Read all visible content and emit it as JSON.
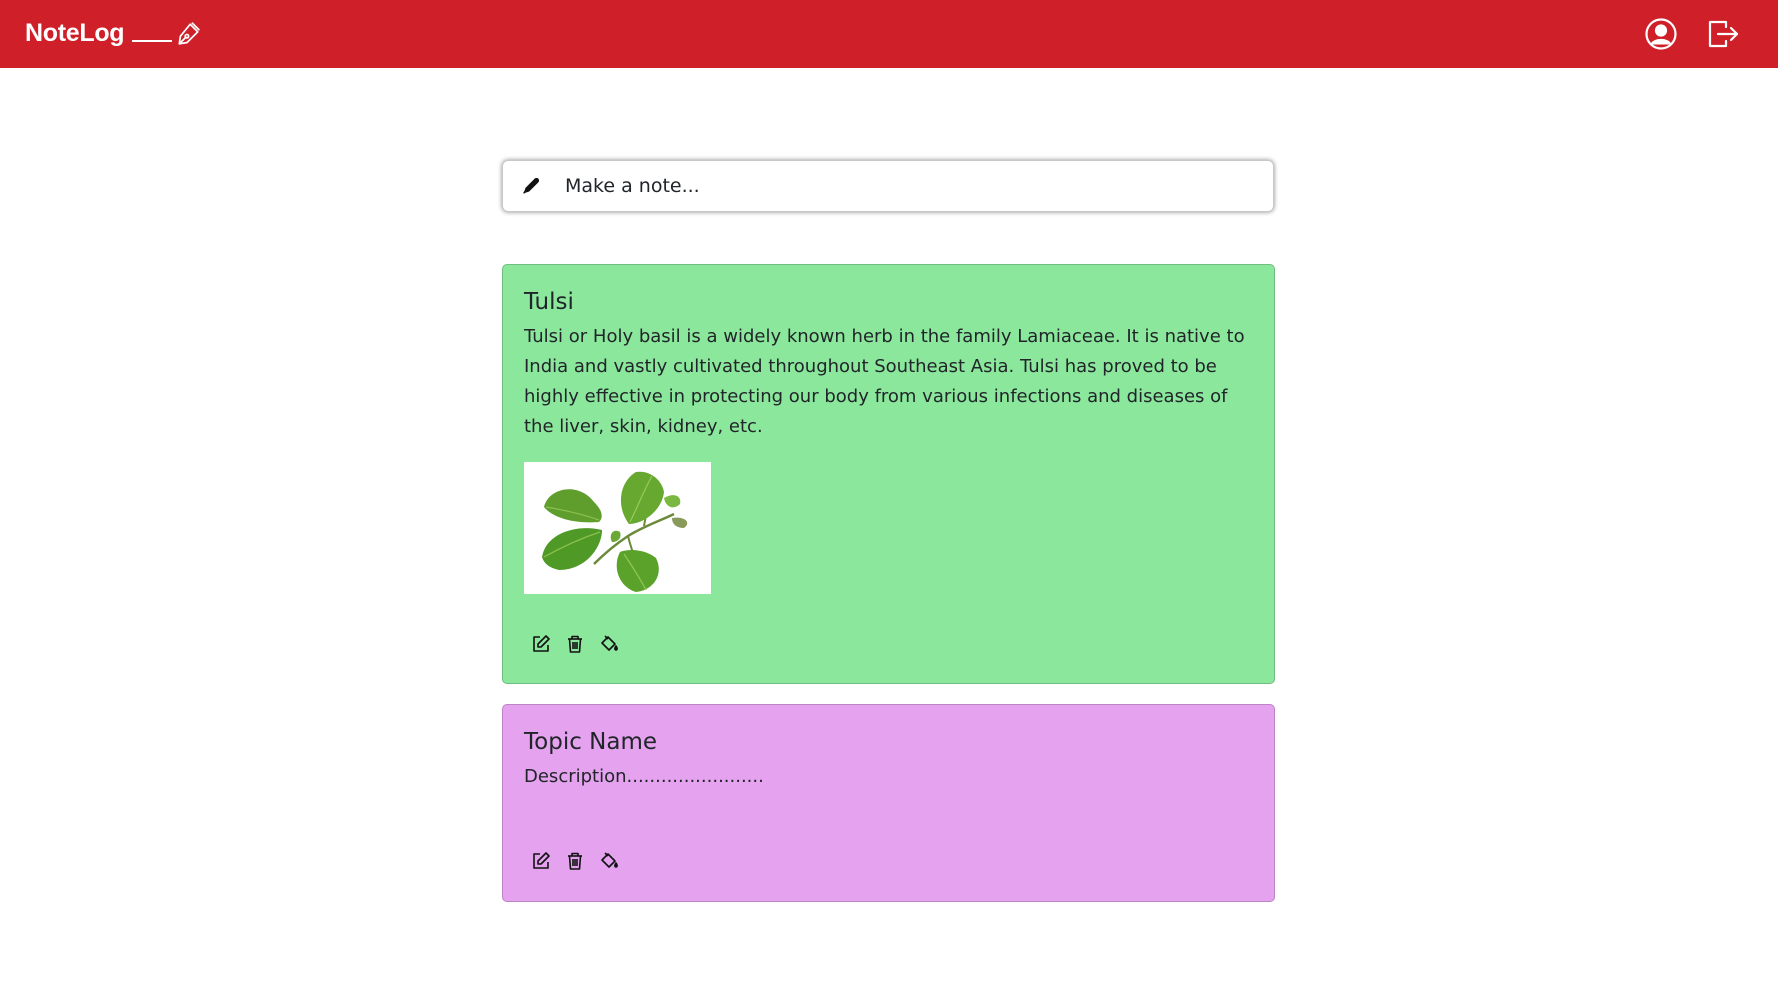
{
  "app": {
    "brand": "NoteLog",
    "colors": {
      "navbar": "#cf1f28",
      "note_green": "#8ae79c",
      "note_purple": "#e4a2ef"
    }
  },
  "navbar": {
    "icons": [
      "pen-nib-icon",
      "user-circle-icon",
      "logout-icon"
    ]
  },
  "composer": {
    "placeholder": "Make a note...",
    "icon": "pencil-icon"
  },
  "notes": [
    {
      "title": "Tulsi",
      "description": "Tulsi or Holy basil is a widely known herb in the family Lamiaceae. It is native to India and vastly cultivated throughout Southeast Asia. Tulsi has proved to be highly effective in protecting our body from various infections and diseases of the liver, skin, kidney, etc.",
      "has_image": true,
      "color": "#8ae79c",
      "actions": [
        "edit-icon",
        "trash-icon",
        "paint-bucket-icon"
      ]
    },
    {
      "title": "Topic Name",
      "description": "Description........................",
      "has_image": false,
      "color": "#e4a2ef",
      "actions": [
        "edit-icon",
        "trash-icon",
        "paint-bucket-icon"
      ]
    }
  ]
}
